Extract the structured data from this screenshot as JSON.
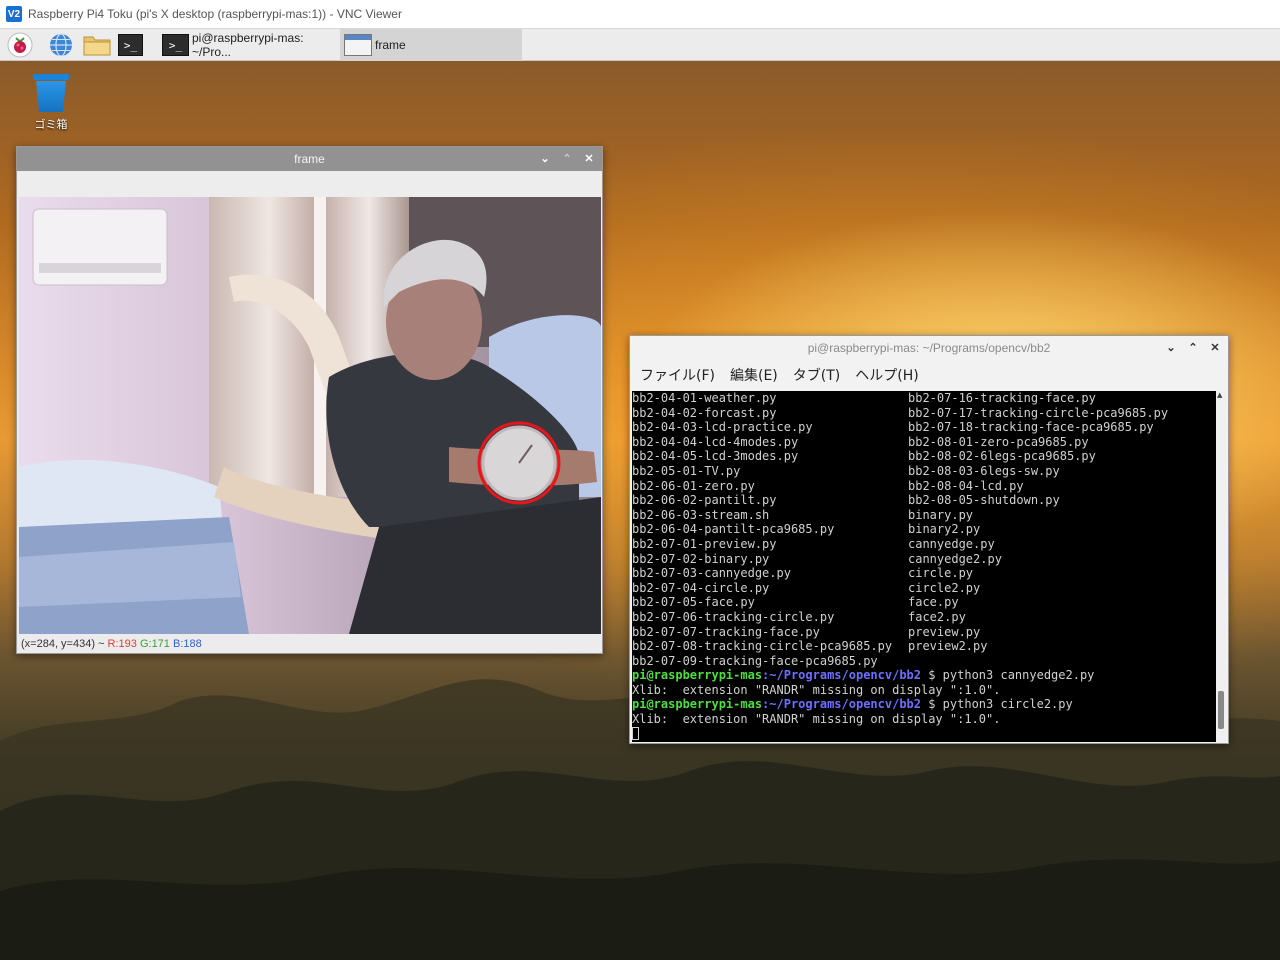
{
  "vnc": {
    "title": "Raspberry Pi4 Toku (pi's X desktop (raspberrypi-mas:1)) - VNC Viewer",
    "logo": "V2"
  },
  "taskbar": {
    "launchers": [
      "raspberry-menu-icon",
      "web-browser-icon",
      "file-manager-icon",
      "terminal-icon"
    ],
    "tasks": [
      {
        "label": "pi@raspberrypi-mas: ~/Pro...",
        "active": false
      },
      {
        "label": "frame",
        "active": true
      }
    ]
  },
  "desktop": {
    "trash_label": "ゴミ箱"
  },
  "frame_window": {
    "title": "frame",
    "status": {
      "coords": "(x=284, y=434) ~ ",
      "r": "R:193",
      "g": "G:171",
      "b": "B:188"
    }
  },
  "terminal_window": {
    "title": "pi@raspberrypi-mas: ~/Programs/opencv/bb2",
    "menu": [
      "ファイル(F)",
      "編集(E)",
      "タブ(T)",
      "ヘルプ(H)"
    ],
    "listing": [
      [
        "bb2-04-01-weather.py",
        "bb2-07-16-tracking-face.py"
      ],
      [
        "bb2-04-02-forcast.py",
        "bb2-07-17-tracking-circle-pca9685.py"
      ],
      [
        "bb2-04-03-lcd-practice.py",
        "bb2-07-18-tracking-face-pca9685.py"
      ],
      [
        "bb2-04-04-lcd-4modes.py",
        "bb2-08-01-zero-pca9685.py"
      ],
      [
        "bb2-04-05-lcd-3modes.py",
        "bb2-08-02-6legs-pca9685.py"
      ],
      [
        "bb2-05-01-TV.py",
        "bb2-08-03-6legs-sw.py"
      ],
      [
        "bb2-06-01-zero.py",
        "bb2-08-04-lcd.py"
      ],
      [
        "bb2-06-02-pantilt.py",
        "bb2-08-05-shutdown.py"
      ],
      [
        "bb2-06-03-stream.sh",
        "binary.py"
      ],
      [
        "bb2-06-04-pantilt-pca9685.py",
        "binary2.py"
      ],
      [
        "bb2-07-01-preview.py",
        "cannyedge.py"
      ],
      [
        "bb2-07-02-binary.py",
        "cannyedge2.py"
      ],
      [
        "bb2-07-03-cannyedge.py",
        "circle.py"
      ],
      [
        "bb2-07-04-circle.py",
        "circle2.py"
      ],
      [
        "bb2-07-05-face.py",
        "face.py"
      ],
      [
        "bb2-07-06-tracking-circle.py",
        "face2.py"
      ],
      [
        "bb2-07-07-tracking-face.py",
        "preview.py"
      ],
      [
        "bb2-07-08-tracking-circle-pca9685.py",
        "preview2.py"
      ],
      [
        "bb2-07-09-tracking-face-pca9685.py",
        ""
      ]
    ],
    "session": [
      {
        "user": "pi@raspberrypi-mas",
        "path": ":~/Programs/opencv/bb2",
        "cmd": " $ python3 cannyedge2.py"
      },
      {
        "output": "Xlib:  extension \"RANDR\" missing on display \":1.0\"."
      },
      {
        "user": "pi@raspberrypi-mas",
        "path": ":~/Programs/opencv/bb2",
        "cmd": " $ python3 circle2.py"
      },
      {
        "output": "Xlib:  extension \"RANDR\" missing on display \":1.0\"."
      }
    ]
  },
  "colors": {
    "prompt_user": "#4fde3f",
    "prompt_path": "#6f6fff",
    "detected_circle": "#e8151a"
  }
}
